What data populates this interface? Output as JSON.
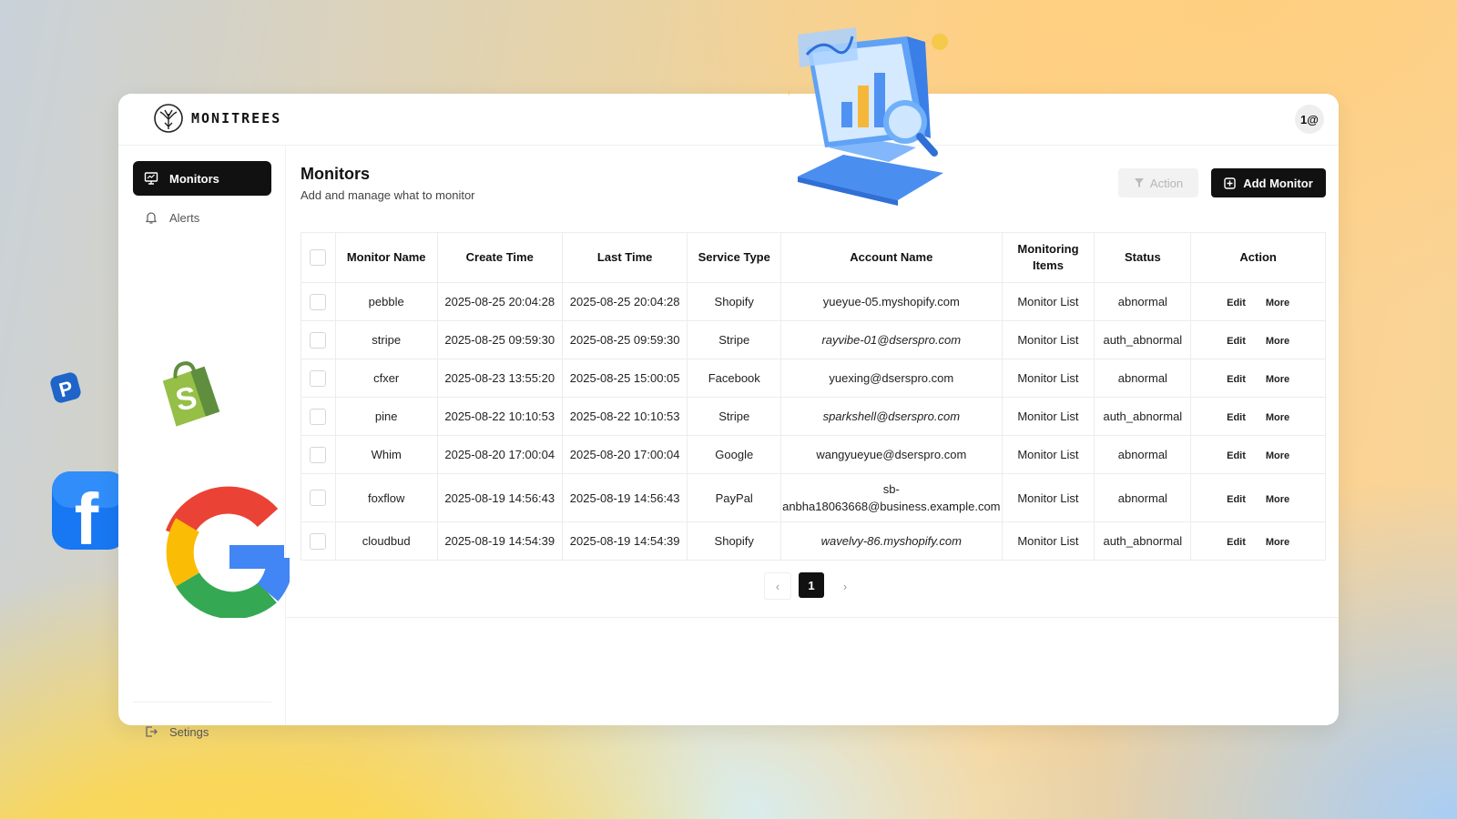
{
  "brand": {
    "name": "MONITREES"
  },
  "avatar": {
    "label": "1@"
  },
  "sidebar": {
    "items": [
      {
        "label": "Monitors",
        "icon": "monitor-icon"
      },
      {
        "label": "Alerts",
        "icon": "bell-icon"
      }
    ],
    "footer": {
      "label": "Setings",
      "icon": "logout-icon"
    }
  },
  "page": {
    "title": "Monitors",
    "subtitle": "Add and manage what to monitor",
    "action_label": "Action",
    "add_label": "Add Monitor"
  },
  "table": {
    "headers": [
      "Monitor Name",
      "Create Time",
      "Last Time",
      "Service Type",
      "Account Name",
      "Monitoring Items",
      "Status",
      "Action"
    ],
    "edit_label": "Edit",
    "more_label": "More",
    "rows": [
      {
        "name": "pebble",
        "create": "2025-08-25 20:04:28",
        "last": "2025-08-25 20:04:28",
        "service": "Shopify",
        "account": "yueyue-05.myshopify.com",
        "items": "Monitor List",
        "status": "abnormal"
      },
      {
        "name": "stripe",
        "create": "2025-08-25 09:59:30",
        "last": "2025-08-25 09:59:30",
        "service": "Stripe",
        "account": "rayvibe-01@dserspro.com",
        "items": "Monitor List",
        "status": "auth_abnormal"
      },
      {
        "name": "cfxer",
        "create": "2025-08-23 13:55:20",
        "last": "2025-08-25 15:00:05",
        "service": "Facebook",
        "account": "yuexing@dserspro.com",
        "items": "Monitor List",
        "status": "abnormal"
      },
      {
        "name": "pine",
        "create": "2025-08-22 10:10:53",
        "last": "2025-08-22 10:10:53",
        "service": "Stripe",
        "account": "sparkshell@dserspro.com",
        "items": "Monitor List",
        "status": "auth_abnormal"
      },
      {
        "name": "Whim",
        "create": "2025-08-20 17:00:04",
        "last": "2025-08-20 17:00:04",
        "service": "Google",
        "account": "wangyueyue@dserspro.com",
        "items": "Monitor List",
        "status": "abnormal"
      },
      {
        "name": "foxflow",
        "create": "2025-08-19 14:56:43",
        "last": "2025-08-19 14:56:43",
        "service": "PayPal",
        "account": "sb-anbha18063668@business.example.com",
        "account_line1": "sb-",
        "account_line2": "anbha18063668@business.example.com",
        "items": "Monitor List",
        "status": "abnormal"
      },
      {
        "name": "cloudbud",
        "create": "2025-08-19 14:54:39",
        "last": "2025-08-19 14:54:39",
        "service": "Shopify",
        "account": "wavelvy-86.myshopify.com",
        "items": "Monitor List",
        "status": "auth_abnormal"
      }
    ]
  },
  "pagination": {
    "prev": "‹",
    "current": "1",
    "next": "›"
  },
  "colors": {
    "accent": "#111111",
    "background_warm": "#ffd187",
    "background_cool": "#a9cdf5"
  }
}
